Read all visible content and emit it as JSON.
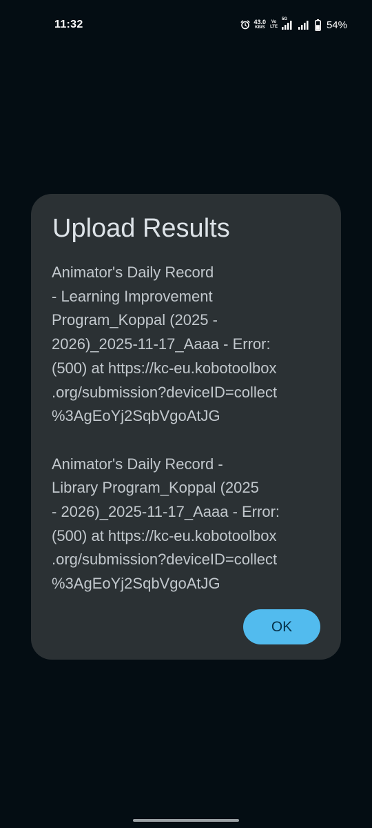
{
  "status_bar": {
    "time": "11:32",
    "icons": [
      "alarm-icon",
      "network-speed-indicator",
      "volte-icon",
      "5g-signal-icon",
      "signal-icon",
      "battery-icon"
    ],
    "network_speed_value": "43.0",
    "network_speed_unit": "KB/S",
    "volte_top": "Vo",
    "volte_bottom": "LTE",
    "network_type": "5G",
    "battery_percent": "54%",
    "battery_level": 0.54
  },
  "dialog": {
    "title": "Upload Results",
    "results": [
      "Animator's Daily Record\n- Learning Improvement\nProgram_Koppal (2025 -\n2026)_2025-11-17_Aaaa - Error:\n(500) at https://kc-eu.kobotoolbox\n.org/submission?deviceID=collect\n%3AgEoYj2SqbVgoAtJG",
      "Animator's Daily Record -\nLibrary Program_Koppal (2025\n- 2026)_2025-11-17_Aaaa - Error:\n(500) at https://kc-eu.kobotoolbox\n.org/submission?deviceID=collect\n%3AgEoYj2SqbVgoAtJG"
    ],
    "ok_label": "OK"
  },
  "colors": {
    "background": "#040d13",
    "dialog_background": "#2b3134",
    "title_text": "#dde3e8",
    "body_text": "#c2c8cd",
    "accent_button": "#52bbee",
    "accent_button_text": "#06324a"
  }
}
